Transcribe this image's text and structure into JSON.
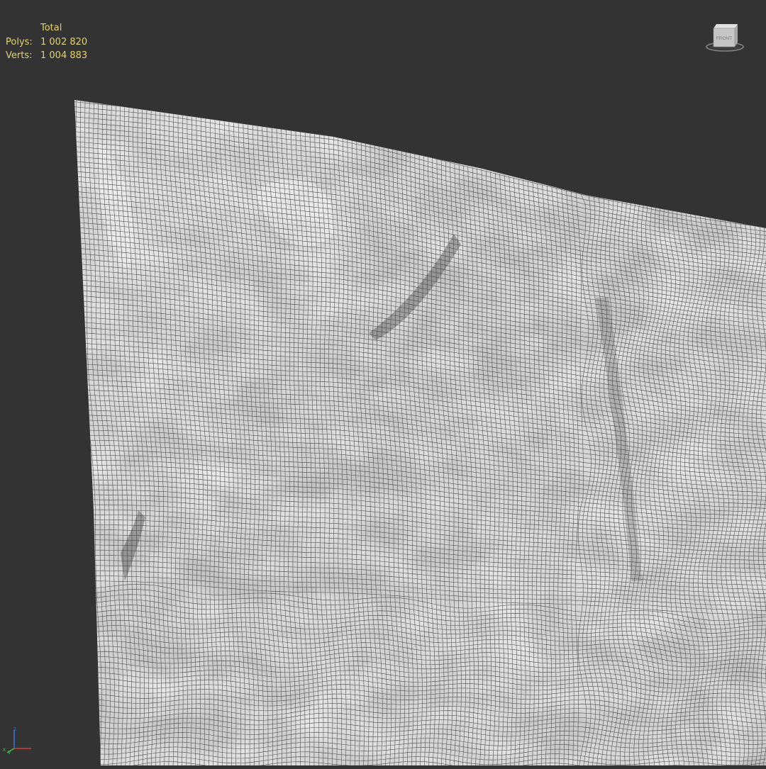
{
  "stats": {
    "header": "Total",
    "polys_label": "Polys:",
    "polys_value": "1 002 820",
    "verts_label": "Verts:",
    "verts_value": "1 004 883"
  },
  "viewcube": {
    "face_label": "FRONT",
    "icon": "viewcube-icon"
  },
  "axis_gizmo": {
    "x_label": "x",
    "y_label": "y",
    "z_label": "z",
    "icon": "axis-tripod-icon"
  },
  "colors": {
    "background": "#333333",
    "stats_text": "#e2d36a",
    "mesh_surface": "#c9c9c9",
    "wire": "#3a3a3a"
  }
}
